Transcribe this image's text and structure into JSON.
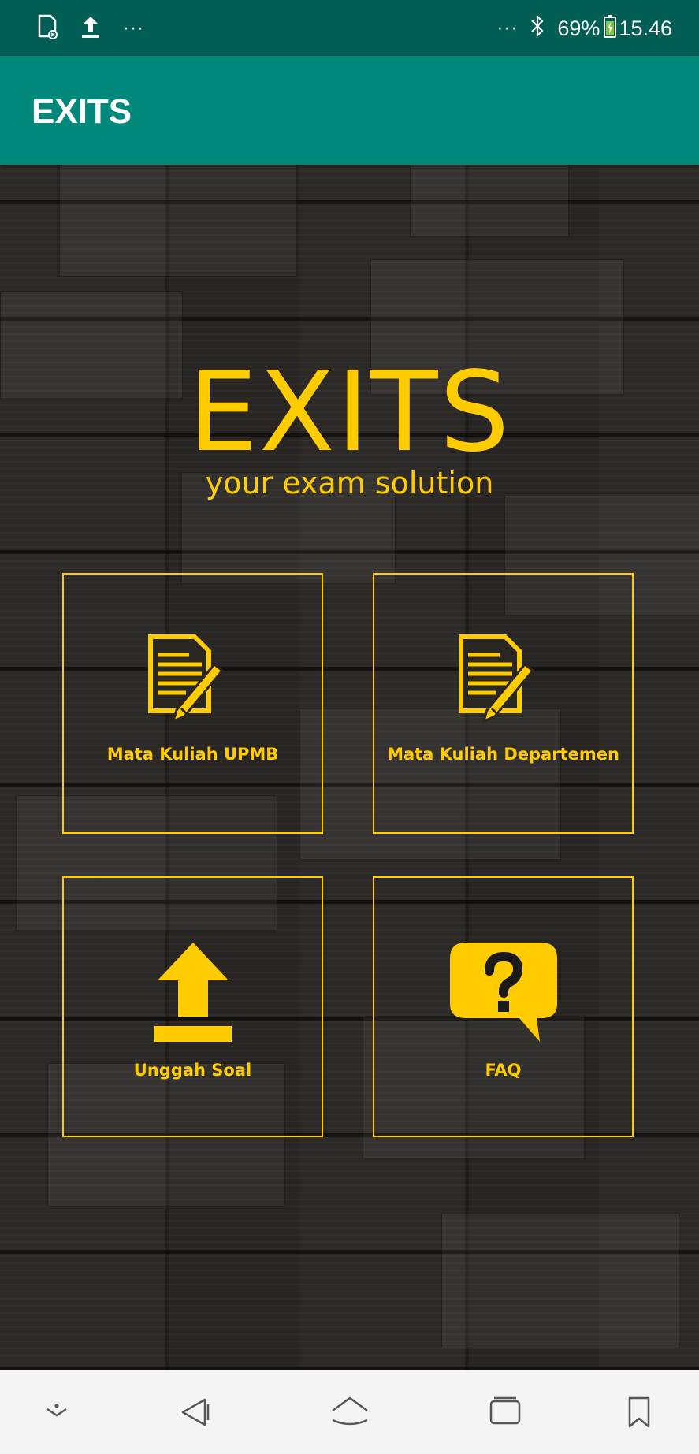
{
  "status_bar": {
    "battery": "69%",
    "time": "15.46",
    "left_icons": [
      "sd-card-icon",
      "upload-icon",
      "more-dots-icon"
    ],
    "right_icons": [
      "more-dots-icon",
      "bluetooth-icon",
      "battery-charging-icon"
    ]
  },
  "app_bar": {
    "title": "EXITS"
  },
  "brand": {
    "logo": "EXITS",
    "tagline": "your exam solution"
  },
  "menu": [
    {
      "label": "Mata Kuliah UPMB",
      "icon": "document-pencil-icon"
    },
    {
      "label": "Mata Kuliah Departemen",
      "icon": "document-pencil-icon"
    },
    {
      "label": "Unggah Soal",
      "icon": "upload-icon"
    },
    {
      "label": "FAQ",
      "icon": "question-bubble-icon"
    }
  ],
  "nav_bar": {
    "icons": [
      "chevron-down-icon",
      "back-icon",
      "home-icon",
      "recents-icon",
      "bookmark-icon"
    ]
  },
  "colors": {
    "status_bar": "#005e55",
    "app_bar": "#00897b",
    "accent": "#ffcc00",
    "nav_bar": "#f4f4f4"
  }
}
